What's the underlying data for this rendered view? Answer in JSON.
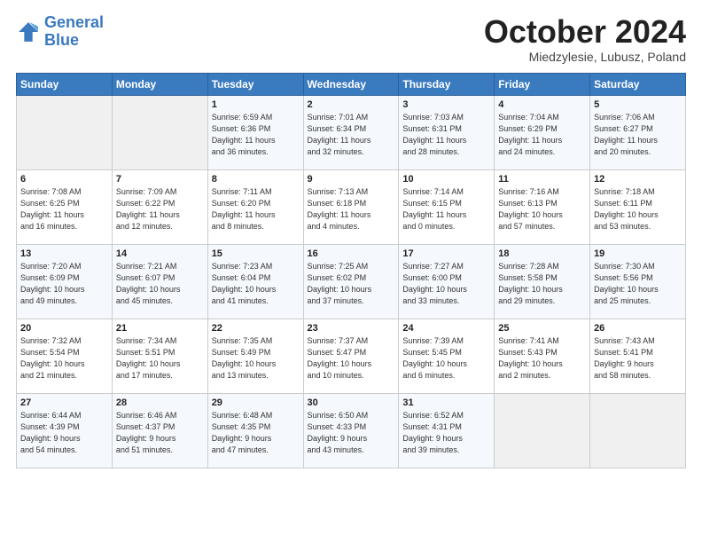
{
  "logo": {
    "line1": "General",
    "line2": "Blue"
  },
  "title": "October 2024",
  "location": "Miedzylesie, Lubusz, Poland",
  "days_of_week": [
    "Sunday",
    "Monday",
    "Tuesday",
    "Wednesday",
    "Thursday",
    "Friday",
    "Saturday"
  ],
  "weeks": [
    [
      {
        "day": "",
        "info": ""
      },
      {
        "day": "",
        "info": ""
      },
      {
        "day": "1",
        "info": "Sunrise: 6:59 AM\nSunset: 6:36 PM\nDaylight: 11 hours\nand 36 minutes."
      },
      {
        "day": "2",
        "info": "Sunrise: 7:01 AM\nSunset: 6:34 PM\nDaylight: 11 hours\nand 32 minutes."
      },
      {
        "day": "3",
        "info": "Sunrise: 7:03 AM\nSunset: 6:31 PM\nDaylight: 11 hours\nand 28 minutes."
      },
      {
        "day": "4",
        "info": "Sunrise: 7:04 AM\nSunset: 6:29 PM\nDaylight: 11 hours\nand 24 minutes."
      },
      {
        "day": "5",
        "info": "Sunrise: 7:06 AM\nSunset: 6:27 PM\nDaylight: 11 hours\nand 20 minutes."
      }
    ],
    [
      {
        "day": "6",
        "info": "Sunrise: 7:08 AM\nSunset: 6:25 PM\nDaylight: 11 hours\nand 16 minutes."
      },
      {
        "day": "7",
        "info": "Sunrise: 7:09 AM\nSunset: 6:22 PM\nDaylight: 11 hours\nand 12 minutes."
      },
      {
        "day": "8",
        "info": "Sunrise: 7:11 AM\nSunset: 6:20 PM\nDaylight: 11 hours\nand 8 minutes."
      },
      {
        "day": "9",
        "info": "Sunrise: 7:13 AM\nSunset: 6:18 PM\nDaylight: 11 hours\nand 4 minutes."
      },
      {
        "day": "10",
        "info": "Sunrise: 7:14 AM\nSunset: 6:15 PM\nDaylight: 11 hours\nand 0 minutes."
      },
      {
        "day": "11",
        "info": "Sunrise: 7:16 AM\nSunset: 6:13 PM\nDaylight: 10 hours\nand 57 minutes."
      },
      {
        "day": "12",
        "info": "Sunrise: 7:18 AM\nSunset: 6:11 PM\nDaylight: 10 hours\nand 53 minutes."
      }
    ],
    [
      {
        "day": "13",
        "info": "Sunrise: 7:20 AM\nSunset: 6:09 PM\nDaylight: 10 hours\nand 49 minutes."
      },
      {
        "day": "14",
        "info": "Sunrise: 7:21 AM\nSunset: 6:07 PM\nDaylight: 10 hours\nand 45 minutes."
      },
      {
        "day": "15",
        "info": "Sunrise: 7:23 AM\nSunset: 6:04 PM\nDaylight: 10 hours\nand 41 minutes."
      },
      {
        "day": "16",
        "info": "Sunrise: 7:25 AM\nSunset: 6:02 PM\nDaylight: 10 hours\nand 37 minutes."
      },
      {
        "day": "17",
        "info": "Sunrise: 7:27 AM\nSunset: 6:00 PM\nDaylight: 10 hours\nand 33 minutes."
      },
      {
        "day": "18",
        "info": "Sunrise: 7:28 AM\nSunset: 5:58 PM\nDaylight: 10 hours\nand 29 minutes."
      },
      {
        "day": "19",
        "info": "Sunrise: 7:30 AM\nSunset: 5:56 PM\nDaylight: 10 hours\nand 25 minutes."
      }
    ],
    [
      {
        "day": "20",
        "info": "Sunrise: 7:32 AM\nSunset: 5:54 PM\nDaylight: 10 hours\nand 21 minutes."
      },
      {
        "day": "21",
        "info": "Sunrise: 7:34 AM\nSunset: 5:51 PM\nDaylight: 10 hours\nand 17 minutes."
      },
      {
        "day": "22",
        "info": "Sunrise: 7:35 AM\nSunset: 5:49 PM\nDaylight: 10 hours\nand 13 minutes."
      },
      {
        "day": "23",
        "info": "Sunrise: 7:37 AM\nSunset: 5:47 PM\nDaylight: 10 hours\nand 10 minutes."
      },
      {
        "day": "24",
        "info": "Sunrise: 7:39 AM\nSunset: 5:45 PM\nDaylight: 10 hours\nand 6 minutes."
      },
      {
        "day": "25",
        "info": "Sunrise: 7:41 AM\nSunset: 5:43 PM\nDaylight: 10 hours\nand 2 minutes."
      },
      {
        "day": "26",
        "info": "Sunrise: 7:43 AM\nSunset: 5:41 PM\nDaylight: 9 hours\nand 58 minutes."
      }
    ],
    [
      {
        "day": "27",
        "info": "Sunrise: 6:44 AM\nSunset: 4:39 PM\nDaylight: 9 hours\nand 54 minutes."
      },
      {
        "day": "28",
        "info": "Sunrise: 6:46 AM\nSunset: 4:37 PM\nDaylight: 9 hours\nand 51 minutes."
      },
      {
        "day": "29",
        "info": "Sunrise: 6:48 AM\nSunset: 4:35 PM\nDaylight: 9 hours\nand 47 minutes."
      },
      {
        "day": "30",
        "info": "Sunrise: 6:50 AM\nSunset: 4:33 PM\nDaylight: 9 hours\nand 43 minutes."
      },
      {
        "day": "31",
        "info": "Sunrise: 6:52 AM\nSunset: 4:31 PM\nDaylight: 9 hours\nand 39 minutes."
      },
      {
        "day": "",
        "info": ""
      },
      {
        "day": "",
        "info": ""
      }
    ]
  ]
}
